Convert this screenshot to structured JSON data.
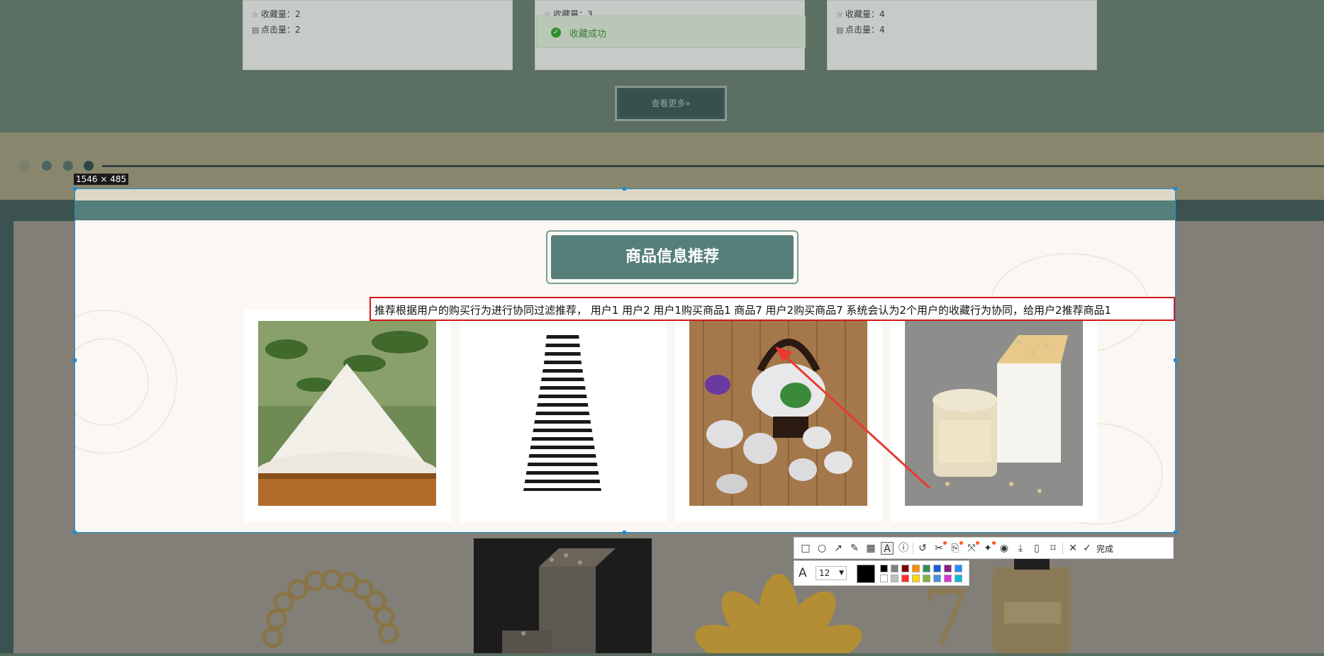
{
  "background_page": {
    "cards": [
      {
        "favorites_label": "收藏量：2",
        "clicks_label": "点击量：2"
      },
      {
        "favorites_label": "收藏量：3",
        "clicks_label": ""
      },
      {
        "favorites_label": "收藏量：4",
        "clicks_label": "点击量：4"
      }
    ],
    "toast": "收藏成功",
    "view_more": "查看更多»"
  },
  "selection": {
    "size_label": "1546 × 485",
    "section_title": "商品信息推荐",
    "annotation_text": "推荐根据用户的购买行为进行协同过滤推荐， 用户1 用户2 用户1购买商品1 商品7 用户2购买商品7 系统会认为2个用户的收藏行为协同，给用户2推荐商品1",
    "products": [
      {
        "name": "flour"
      },
      {
        "name": "striped-dress"
      },
      {
        "name": "tea-set"
      },
      {
        "name": "honey-jar-gift-box"
      }
    ]
  },
  "toolbar": {
    "icons": [
      "rectangle-icon",
      "ellipse-icon",
      "arrow-icon",
      "pencil-icon",
      "mosaic-icon",
      "text-icon",
      "serial-number-icon",
      "undo-icon",
      "pin-icon",
      "translate-icon",
      "expand-icon",
      "magic-icon",
      "record-icon",
      "download-icon",
      "long-screenshot-icon",
      "bookmark-icon",
      "close-icon",
      "check-icon"
    ],
    "done_label": "完成",
    "font_size": "12",
    "color_swatches": [
      "#000000",
      "#808080",
      "#800000",
      "#ff8c00",
      "#2e8b57",
      "#1e5bd6",
      "#8b1a8b",
      "#1e90ff",
      "#ffffff",
      "#c0c0c0",
      "#ff3030",
      "#ffd700",
      "#7cb342",
      "#4a90e2",
      "#d836d8",
      "#00bcd4"
    ],
    "selected_color": "#000000"
  }
}
